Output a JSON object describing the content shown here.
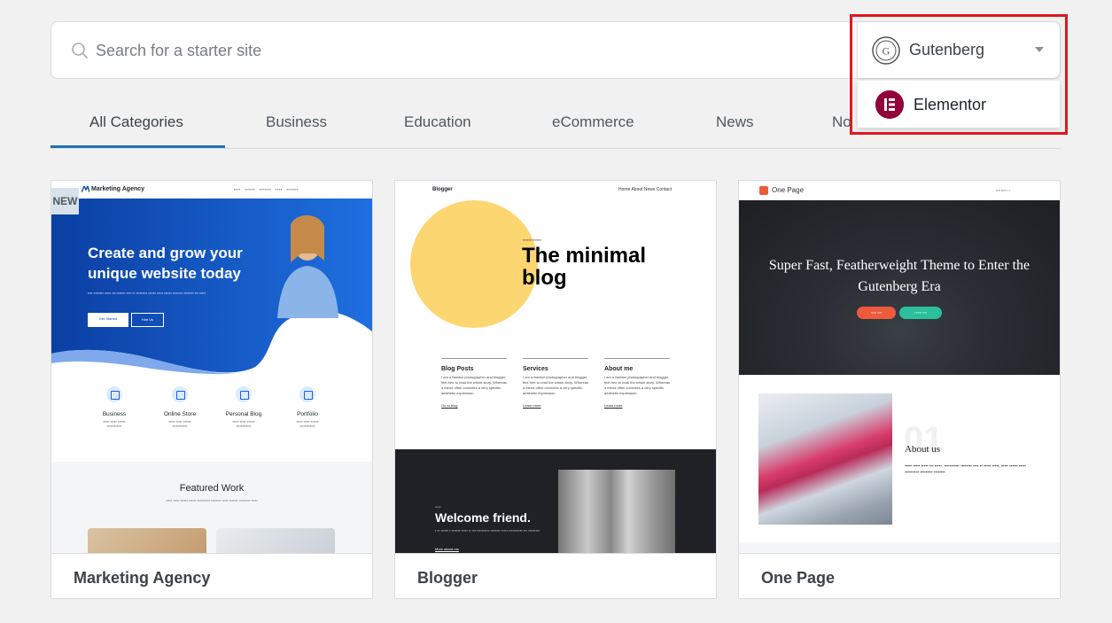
{
  "search": {
    "placeholder": "Search for a starter site"
  },
  "builder": {
    "selected": "Gutenberg",
    "options": [
      "Elementor"
    ]
  },
  "tabs": [
    {
      "label": "All Categories"
    },
    {
      "label": "Business"
    },
    {
      "label": "Education"
    },
    {
      "label": "eCommerce"
    },
    {
      "label": "News"
    },
    {
      "label": "No"
    }
  ],
  "cards": [
    {
      "title": "Marketing Agency",
      "badge": "NEW",
      "preview": {
        "logo": "Marketing Agency",
        "hero": "Create and grow your unique website today",
        "primary_button": "Get Started",
        "secondary_button": "Hire Us",
        "features": [
          "Business",
          "Online Store",
          "Personal Blog",
          "Portfolio"
        ],
        "section_title": "Featured Work"
      }
    },
    {
      "title": "Blogger",
      "preview": {
        "logo": "Blogger",
        "nav": "Home   About   News   Contact",
        "headline": "The minimal blog",
        "columns": [
          {
            "title": "Blog Posts",
            "text": "I am a fashion photographer and blogger, feel free to read the whole story. Whereas a friend often connotes a very specific aesthetic expression.",
            "link": "Go to blog"
          },
          {
            "title": "Services",
            "text": "I am a fashion photographer and blogger, feel free to read the whole story. Whereas a friend often connotes a very specific aesthetic expression.",
            "link": "Learn more"
          },
          {
            "title": "About me",
            "text": "I am a fashion photographer and blogger, feel free to read the whole story. Whereas a friend often connotes a very specific aesthetic expression.",
            "link": "Learn more"
          }
        ],
        "welcome": "Welcome friend.",
        "welcome_link": "More about me"
      }
    },
    {
      "title": "One Page",
      "preview": {
        "logo": "One Page",
        "hero": "Super Fast, Featherweight Theme to Enter the Gutenberg Era",
        "about_number": "01",
        "about_title": "About us"
      }
    }
  ],
  "colors": {
    "accent": "#2271b1",
    "highlight": "#e0171f",
    "elementor": "#92003b",
    "blogger_yellow": "#fcd671",
    "marketing_blue": "#0b4db5"
  }
}
